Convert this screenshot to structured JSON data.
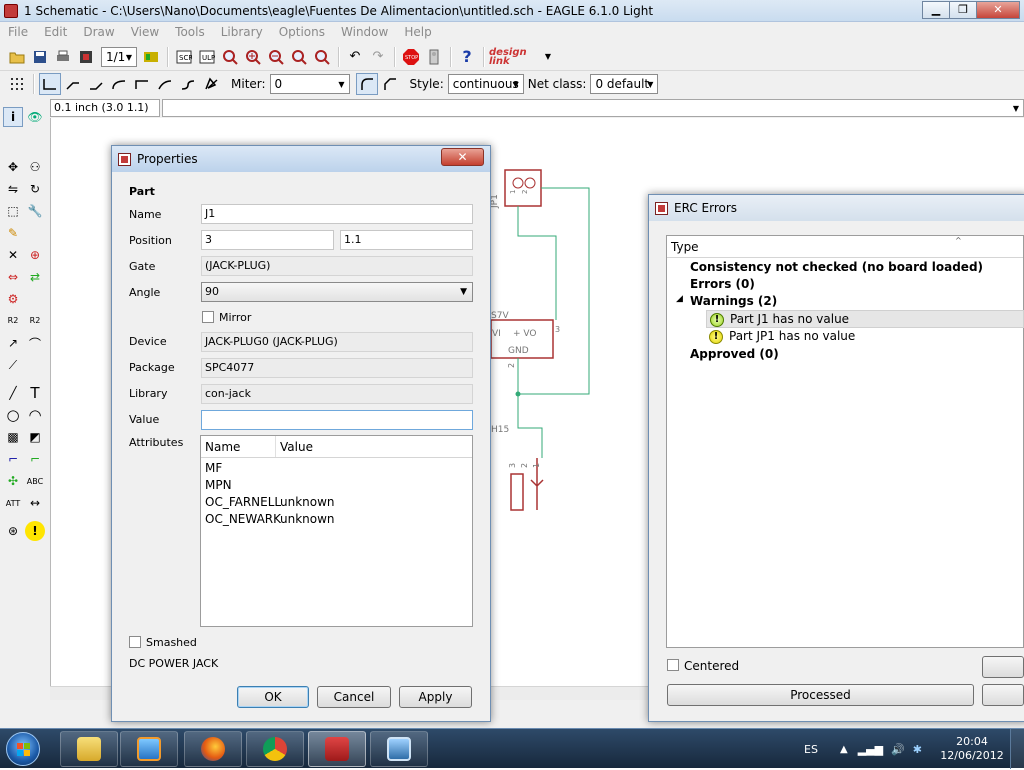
{
  "window": {
    "title": "1 Schematic - C:\\Users\\Nano\\Documents\\eagle\\Fuentes De Alimentacion\\untitled.sch - EAGLE 6.1.0 Light",
    "minimize_glyph": "▁",
    "maximize_glyph": "❐",
    "close_glyph": "✕"
  },
  "menu": [
    "File",
    "Edit",
    "Draw",
    "View",
    "Tools",
    "Library",
    "Options",
    "Window",
    "Help"
  ],
  "toolbar": {
    "zoom_select": "1/1",
    "design_link": "design link"
  },
  "toolbar2": {
    "miter_label": "Miter:",
    "miter_value": "0",
    "style_label": "Style:",
    "style_value": "continuous",
    "netclass_label": "Net class:",
    "netclass_value": "0 default"
  },
  "coordinate_readout": "0.1 inch (3.0 1.1)",
  "schematic": {
    "labels": [
      "JP1",
      "1",
      "2",
      "S7V",
      "VI",
      "+ VO",
      "GND",
      "3",
      "2",
      "H15",
      "3",
      "2",
      "1"
    ]
  },
  "properties": {
    "title": "Properties",
    "section": "Part",
    "name_label": "Name",
    "name_value": "J1",
    "position_label": "Position",
    "position_x": "3",
    "position_y": "1.1",
    "gate_label": "Gate",
    "gate_value": "(JACK-PLUG)",
    "angle_label": "Angle",
    "angle_value": "90",
    "mirror_label": "Mirror",
    "device_label": "Device",
    "device_value": "JACK-PLUG0 (JACK-PLUG)",
    "package_label": "Package",
    "package_value": "SPC4077",
    "library_label": "Library",
    "library_value": "con-jack",
    "value_label": "Value",
    "value_value": "",
    "attributes_label": "Attributes",
    "attr_col_name": "Name",
    "attr_col_value": "Value",
    "attributes": [
      {
        "name": "MF",
        "value": ""
      },
      {
        "name": "MPN",
        "value": ""
      },
      {
        "name": "OC_FARNELL",
        "value": "unknown"
      },
      {
        "name": "OC_NEWARK",
        "value": "unknown"
      }
    ],
    "smashed_label": "Smashed",
    "description": "DC POWER JACK",
    "ok": "OK",
    "cancel": "Cancel",
    "apply": "Apply"
  },
  "erc": {
    "title": "ERC Errors",
    "col_type": "Type",
    "consistency": "Consistency not checked (no board loaded)",
    "errors": "Errors (0)",
    "warnings": "Warnings (2)",
    "warning_items": [
      "Part J1 has no value",
      "Part JP1 has no value"
    ],
    "approved": "Approved (0)",
    "centered_label": "Centered",
    "processed": "Processed"
  },
  "taskbar": {
    "lang": "ES",
    "time": "20:04",
    "date": "12/06/2012"
  }
}
